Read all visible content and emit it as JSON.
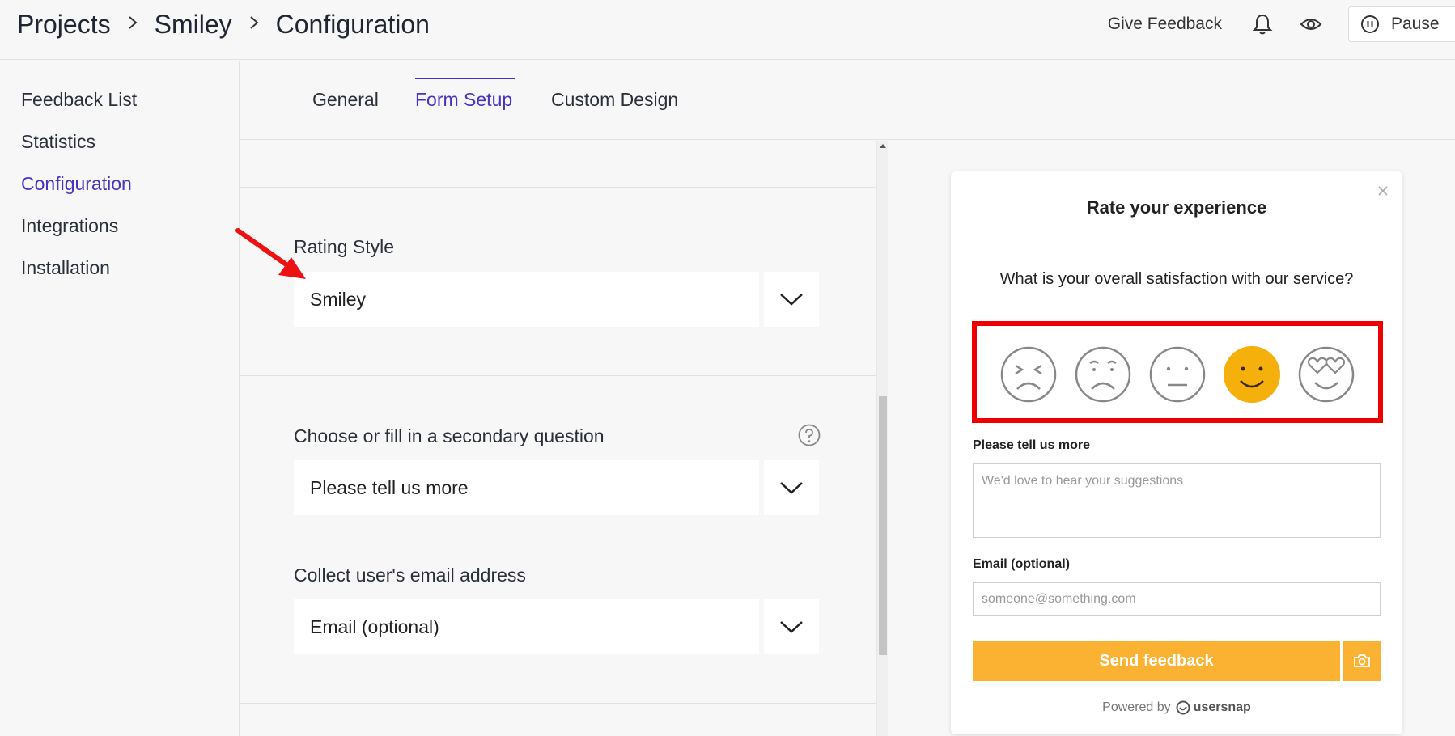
{
  "header": {
    "breadcrumbs": [
      "Projects",
      "Smiley",
      "Configuration"
    ],
    "give_feedback": "Give Feedback",
    "pause": "Pause"
  },
  "sidebar": {
    "items": [
      {
        "label": "Feedback List",
        "active": false
      },
      {
        "label": "Statistics",
        "active": false
      },
      {
        "label": "Configuration",
        "active": true
      },
      {
        "label": "Integrations",
        "active": false
      },
      {
        "label": "Installation",
        "active": false
      }
    ]
  },
  "tabs": [
    {
      "label": "General",
      "active": false
    },
    {
      "label": "Form Setup",
      "active": true
    },
    {
      "label": "Custom Design",
      "active": false
    }
  ],
  "form": {
    "rating_style": {
      "label": "Rating Style",
      "value": "Smiley"
    },
    "secondary_question": {
      "label": "Choose or fill in a secondary question",
      "value": "Please tell us more"
    },
    "email": {
      "label": "Collect user's email address",
      "value": "Email (optional)"
    }
  },
  "widget": {
    "title": "Rate your experience",
    "question": "What is your overall satisfaction with our service?",
    "selected_rating": 4,
    "rating_count": 5,
    "comment_label": "Please tell us more",
    "comment_placeholder": "We'd love to hear your suggestions",
    "email_label": "Email (optional)",
    "email_placeholder": "someone@something.com",
    "send_label": "Send feedback",
    "powered_by": "Powered by",
    "brand": "usersnap"
  },
  "colors": {
    "accent": "#4a33c2",
    "button": "#fbb131",
    "selected_smiley": "#f5b00b",
    "highlight": "#ee0000",
    "annotation_arrow": "#ee1111"
  },
  "icons": [
    "chevron-right-icon",
    "bell-icon",
    "eye-icon",
    "pause-icon",
    "chevron-down-icon",
    "help-icon",
    "close-icon",
    "camera-icon",
    "usersnap-logo-icon"
  ]
}
